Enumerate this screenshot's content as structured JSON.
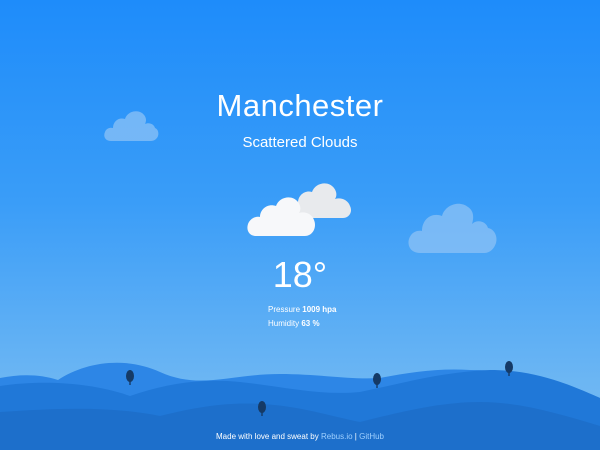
{
  "weather": {
    "city": "Manchester",
    "condition": "Scattered Clouds",
    "temperature": "18°",
    "pressure_label": "Pressure",
    "pressure_value": "1009 hpa",
    "humidity_label": "Humidity",
    "humidity_value": "63 %",
    "icon": "scattered-clouds-icon"
  },
  "footer": {
    "text": "Made with love and sweat by",
    "rebus_link": "Rebus.io",
    "separator": "|",
    "github_link": "GitHub"
  },
  "colors": {
    "sky_top": "#1e8cfa",
    "sky_bottom": "#78bcf2",
    "hill_back": "#2d86e6",
    "hill_mid": "#2078d8",
    "hill_front": "#1d6fcb",
    "tree": "#153a66",
    "cloud": "#f4f5f7",
    "bg_cloud": "#8cc2f5"
  }
}
